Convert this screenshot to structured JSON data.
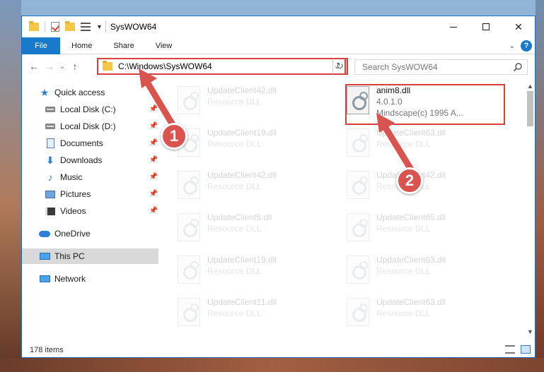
{
  "window": {
    "title": "SysWOW64"
  },
  "ribbon": {
    "tabs": [
      "File",
      "Home",
      "Share",
      "View"
    ]
  },
  "address": {
    "path": "C:\\Windows\\SysWOW64"
  },
  "search": {
    "placeholder": "Search SysWOW64"
  },
  "sidebar": {
    "items": [
      {
        "label": "Quick access",
        "icon": "star-icon"
      },
      {
        "label": "Local Disk (C:)",
        "icon": "drive-icon",
        "pinned": true
      },
      {
        "label": "Local Disk (D:)",
        "icon": "drive-icon",
        "pinned": true
      },
      {
        "label": "Documents",
        "icon": "documents-icon",
        "pinned": true
      },
      {
        "label": "Downloads",
        "icon": "downloads-icon",
        "pinned": true
      },
      {
        "label": "Music",
        "icon": "music-icon",
        "pinned": true
      },
      {
        "label": "Pictures",
        "icon": "pictures-icon",
        "pinned": true
      },
      {
        "label": "Videos",
        "icon": "videos-icon",
        "pinned": true
      },
      {
        "label": "OneDrive",
        "icon": "cloud-icon"
      },
      {
        "label": "This PC",
        "icon": "computer-icon",
        "selected": true
      },
      {
        "label": "Network",
        "icon": "network-icon"
      }
    ]
  },
  "files": {
    "highlighted": {
      "name": "anim8.dll",
      "version": "4.0.1.0",
      "company": "Mindscape(c) 1995 A..."
    },
    "left_column": [
      {
        "name": "UpdateClient42.dll",
        "type": "Resource DLL"
      },
      {
        "name": "UpdateClient19.dll",
        "type": "Resource DLL"
      },
      {
        "name": "UpdateClient42.dll",
        "type": "Resource DLL"
      },
      {
        "name": "UpdateClient5.dll",
        "type": "Resource DLL"
      },
      {
        "name": "UpdateClient19.dll",
        "type": "Resource DLL"
      },
      {
        "name": "UpdateClient21.dll",
        "type": "Resource DLL"
      }
    ],
    "right_column": [
      {
        "name": "UpdateClient63.dll",
        "type": "Resource DLL"
      },
      {
        "name": "UpdateClient42.dll",
        "type": "Resource DLL"
      },
      {
        "name": "UpdateClient65.dll",
        "type": "Resource DLL"
      },
      {
        "name": "UpdateClient63.dll",
        "type": "Resource DLL"
      },
      {
        "name": "UpdateClient63.dll",
        "type": "Resource DLL"
      }
    ]
  },
  "status": {
    "item_count": "178 items"
  },
  "callouts": {
    "step1": "1",
    "step2": "2"
  },
  "colors": {
    "accent": "#1979ca",
    "callout": "#d9534f",
    "highlight_border": "#d93f3f"
  }
}
